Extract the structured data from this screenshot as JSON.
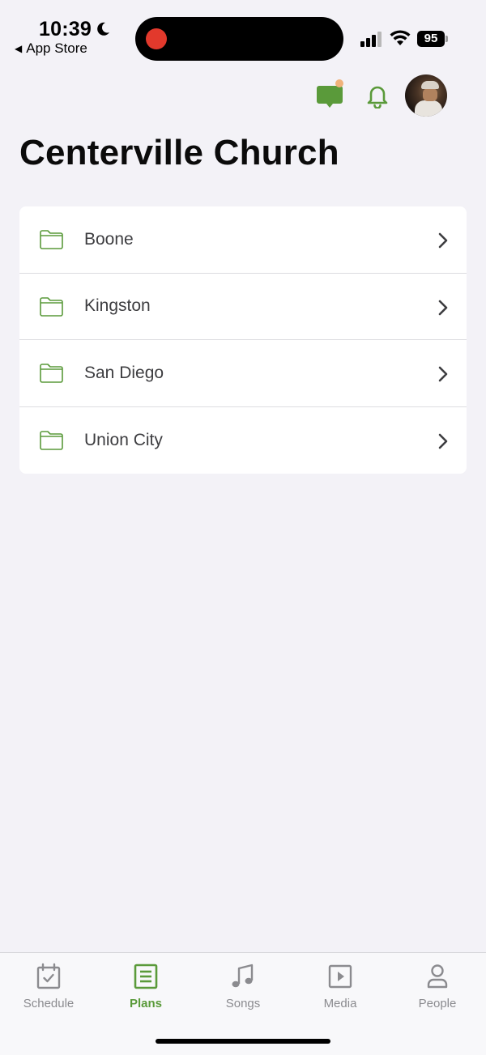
{
  "status_bar": {
    "time": "10:39",
    "back_label": "App Store",
    "battery": "95"
  },
  "header": {
    "title": "Centerville Church"
  },
  "folders": [
    {
      "label": "Boone"
    },
    {
      "label": "Kingston"
    },
    {
      "label": "San Diego"
    },
    {
      "label": "Union City"
    }
  ],
  "tabs": [
    {
      "label": "Schedule",
      "icon": "calendar-check-icon",
      "active": false
    },
    {
      "label": "Plans",
      "icon": "document-lines-icon",
      "active": true
    },
    {
      "label": "Songs",
      "icon": "music-note-icon",
      "active": false
    },
    {
      "label": "Media",
      "icon": "play-square-icon",
      "active": false
    },
    {
      "label": "People",
      "icon": "person-icon",
      "active": false
    }
  ],
  "colors": {
    "accent": "#5a9a3a",
    "background": "#f3f2f7",
    "tab_inactive": "#8b8b8f",
    "notification_dot": "#f0b27a",
    "record_dot": "#e2392c"
  }
}
